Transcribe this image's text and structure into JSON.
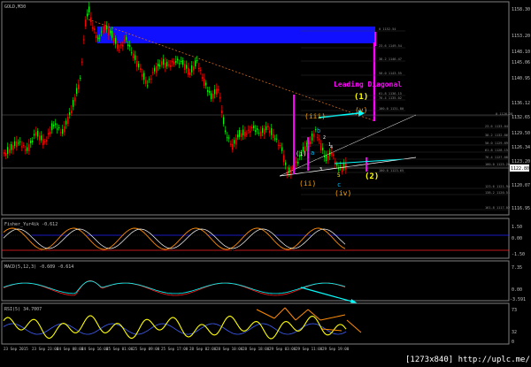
{
  "window": {
    "symbol_label": "GOLD,M30"
  },
  "main_chart": {
    "wave_title": "Leading Diagonal",
    "wave_labels": {
      "one": "(1)",
      "two": "(2)",
      "iii": "(iii)",
      "v": "(v)",
      "ii": "(ii)",
      "iv": "(iv)",
      "i": "(i)",
      "b": "b",
      "a": "a",
      "c": "c",
      "n1": "1",
      "n2": "2",
      "n3": "3",
      "n4": "4",
      "n5": "5"
    },
    "price_axis": [
      "1158.30",
      "1153.20",
      "1148.10",
      "1145.06",
      "1140.95",
      "1136.12",
      "1132.65",
      "1129.50",
      "1126.34",
      "1123.20",
      "1122.80",
      "1120.07",
      "1116.95"
    ],
    "current_price": "1122.80",
    "fib_labels": [
      "0 1152.54",
      "23.6 1149.54",
      "38.2 1146.47",
      "50.0 1143.55",
      "61.8 1136.15",
      "76.4 1135.02",
      "100.0 1131.80",
      "0 1126.28",
      "23.6 1133.04",
      "38.2 1132.86",
      "50.0 1129.89",
      "61.8 1128.15",
      "76.4 1127.08",
      "100.0 1125.20",
      "100.0 1123.65",
      "123.6 1121.94",
      "138.2 1120.51",
      "161.8 1117.02"
    ]
  },
  "indicators": {
    "fisher": {
      "label": "Fisher_Yur4ik -0.612",
      "axis": [
        "1.50",
        "0.00",
        "-1.50"
      ]
    },
    "macd": {
      "label": "MACD(5,12,3) -0.609 -0.614",
      "axis": [
        "7.35",
        "0.00",
        "-3.591"
      ]
    },
    "rsi": {
      "label": "RSI(5) 34.7007",
      "axis": [
        "73",
        "32",
        "0"
      ]
    }
  },
  "time_axis": [
    "23 Sep 2015",
    "23 Sep 23:00",
    "24 Sep 08:00",
    "24 Sep 16:00",
    "25 Sep 01:00",
    "25 Sep 09:00",
    "25 Sep 17:00",
    "28 Sep 02:00",
    "28 Sep 10:00",
    "28 Sep 18:00",
    "29 Sep 03:00",
    "29 Sep 11:00",
    "29 Sep 19:00"
  ],
  "watermark": "[1273x840] http://uplc.me/",
  "colors": {
    "up_candle": "#00ff00",
    "down_candle": "#ff0000",
    "blue_zone": "#1010ff",
    "magenta": "#ff00ff",
    "yellow": "#ffff00",
    "orange": "#ffa500",
    "cyan": "#00ffff"
  }
}
